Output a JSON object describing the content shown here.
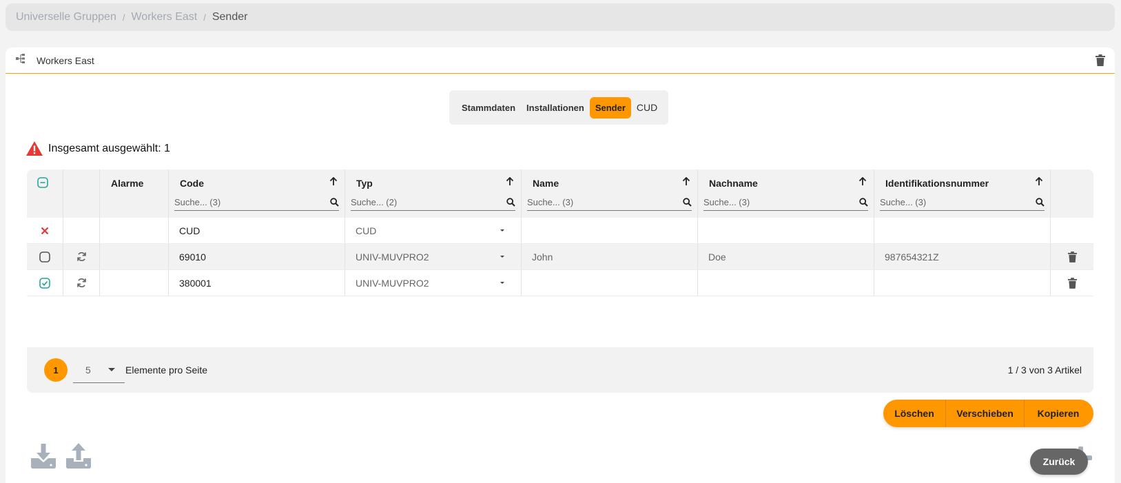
{
  "breadcrumb": {
    "items": [
      "Universelle Gruppen",
      "Workers East"
    ],
    "current": "Sender",
    "separator": "/"
  },
  "card": {
    "title": "Workers East",
    "icon": "hierarchy-icon",
    "accent": "#f0a800"
  },
  "tabs": {
    "items": [
      "Stammdaten",
      "Installationen",
      "Sender",
      "CUD"
    ],
    "active": "Sender",
    "active_color": "#ff9800"
  },
  "warning": {
    "text": "Insgesamt ausgewählt: 1",
    "icon": "warning-triangle-icon",
    "color": "#e53935"
  },
  "table": {
    "columns": [
      {
        "label": "Alarme"
      },
      {
        "label": "Code",
        "placeholder": "Suche... (3)"
      },
      {
        "label": "Typ",
        "placeholder": "Suche... (2)"
      },
      {
        "label": "Name",
        "placeholder": "Suche... (3)"
      },
      {
        "label": "Nachname",
        "placeholder": "Suche... (3)"
      },
      {
        "label": "Identifikationsnummer",
        "placeholder": "Suche... (3)"
      }
    ],
    "rows": [
      {
        "state": "error",
        "sync": false,
        "code": "CUD",
        "typ": "CUD",
        "name": "",
        "nachname": "",
        "id": "",
        "delete": false
      },
      {
        "state": "unchecked",
        "sync": true,
        "code": "69010",
        "typ": "UNIV-MUVPRO2",
        "name": "John",
        "nachname": "Doe",
        "id": "987654321Z",
        "delete": true
      },
      {
        "state": "checked",
        "sync": true,
        "code": "380001",
        "typ": "UNIV-MUVPRO2",
        "name": "",
        "nachname": "",
        "id": "",
        "delete": true
      }
    ]
  },
  "pagination": {
    "page": "1",
    "per_page": "5",
    "per_page_label": "Elemente pro Seite",
    "info": "1 / 3 von 3 Artikel"
  },
  "actions": {
    "delete": "Löschen",
    "move": "Verschieben",
    "copy": "Kopieren"
  },
  "back": "Zurück",
  "colors": {
    "accent": "#ff9800",
    "check_green": "#26a69a",
    "error_red": "#e53935",
    "icon_gray": "#a7b0bb"
  }
}
